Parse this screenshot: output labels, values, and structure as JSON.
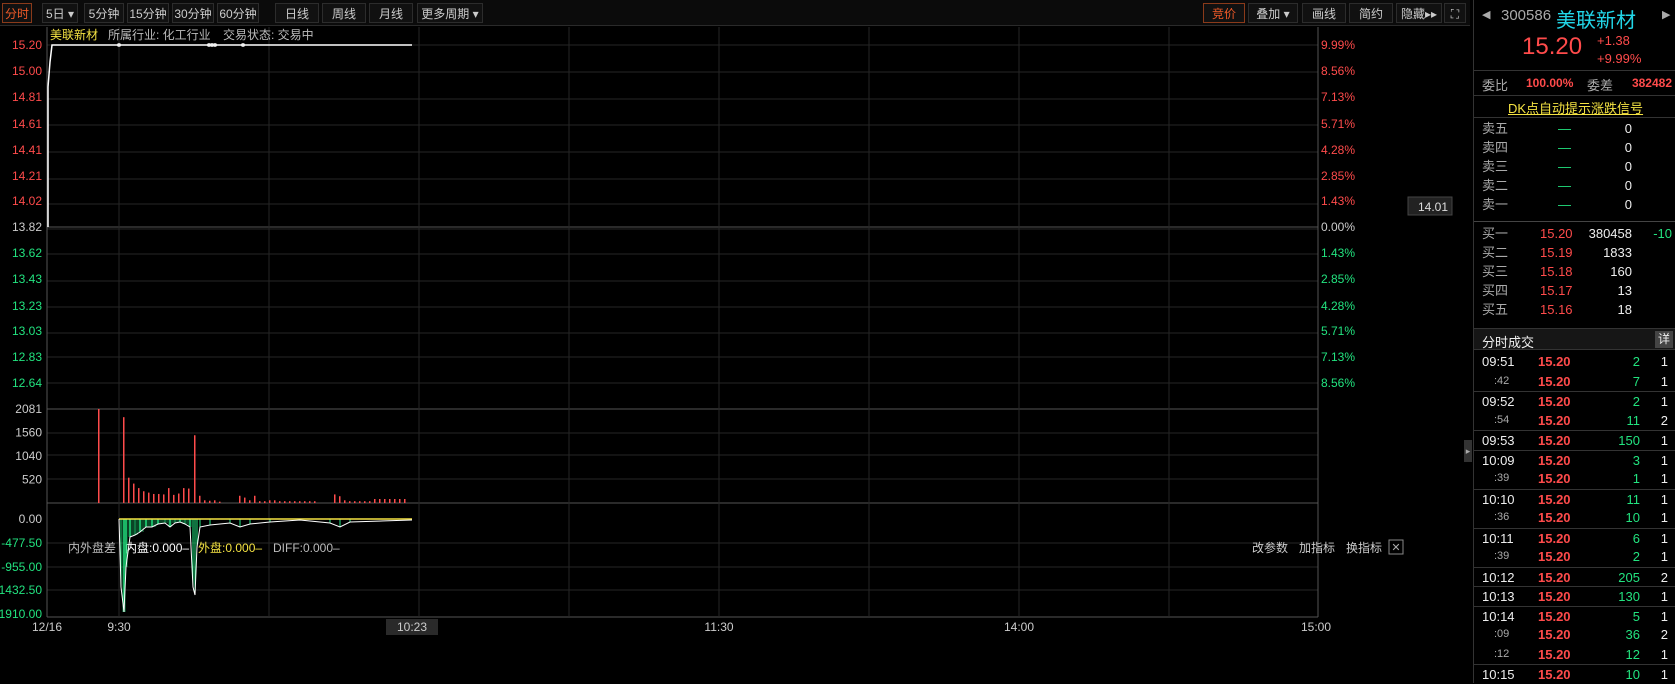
{
  "toolbar": {
    "left": [
      "分时",
      "5日",
      "5分钟",
      "15分钟",
      "30分钟",
      "60分钟",
      "日线",
      "周线",
      "月线",
      "更多周期"
    ],
    "right": [
      "竞价",
      "叠加",
      "画线",
      "简约",
      "隐藏"
    ]
  },
  "info": {
    "name": "美联新材",
    "industry": "所属行业: 化工行业",
    "status": "交易状态: 交易中"
  },
  "price_axis": {
    "left": [
      "15.20",
      "15.00",
      "14.81",
      "14.61",
      "14.41",
      "14.21",
      "14.02",
      "13.82",
      "13.62",
      "13.43",
      "13.23",
      "13.03",
      "12.83",
      "12.64"
    ],
    "right": [
      "9.99%",
      "8.56%",
      "7.13%",
      "5.71%",
      "4.28%",
      "2.85%",
      "1.43%",
      "0.00%",
      "1.43%",
      "2.85%",
      "4.28%",
      "5.71%",
      "7.13%",
      "8.56%"
    ],
    "cursor": "14.01"
  },
  "volume_axis": [
    "2081",
    "1560",
    "1040",
    "520"
  ],
  "indicator": {
    "name": "内外盘差",
    "inner": "内盘:0.000–",
    "outer": "外盘:0.000–",
    "diff": "DIFF:0.000–",
    "axis": [
      "0.00",
      "-477.50",
      "-955.00",
      "-1432.50",
      "-1910.00"
    ],
    "buttons": [
      "改参数",
      "加指标",
      "换指标"
    ]
  },
  "time_axis": {
    "date": "12/16",
    "labels": [
      "9:30",
      "10:23",
      "11:30",
      "14:00",
      "15:00"
    ]
  },
  "quote": {
    "code": "300586",
    "name": "美联新材",
    "price": "15.20",
    "change": "+1.38",
    "pct": "+9.99%",
    "ratio_label": "委比",
    "ratio": "100.00%",
    "diff_label": "委差",
    "diff": "382482",
    "link": "DK点自动提示涨跌信号"
  },
  "sells": [
    {
      "label": "卖五",
      "price": "—",
      "vol": "0"
    },
    {
      "label": "卖四",
      "price": "—",
      "vol": "0"
    },
    {
      "label": "卖三",
      "price": "—",
      "vol": "0"
    },
    {
      "label": "卖二",
      "price": "—",
      "vol": "0"
    },
    {
      "label": "卖一",
      "price": "—",
      "vol": "0"
    }
  ],
  "buys": [
    {
      "label": "买一",
      "price": "15.20",
      "vol": "380458",
      "chg": "-10"
    },
    {
      "label": "买二",
      "price": "15.19",
      "vol": "1833",
      "chg": ""
    },
    {
      "label": "买三",
      "price": "15.18",
      "vol": "160",
      "chg": ""
    },
    {
      "label": "买四",
      "price": "15.17",
      "vol": "13",
      "chg": ""
    },
    {
      "label": "买五",
      "price": "15.16",
      "vol": "18",
      "chg": ""
    }
  ],
  "ticks_title": "分时成交",
  "ticks_btn": "详",
  "ticks": [
    {
      "t": "09:51",
      "p": "15.20",
      "v": "2",
      "n": "1"
    },
    {
      "t": ":42",
      "p": "15.20",
      "v": "7",
      "n": "1"
    },
    {
      "t": "09:52",
      "p": "15.20",
      "v": "2",
      "n": "1"
    },
    {
      "t": ":54",
      "p": "15.20",
      "v": "11",
      "n": "2"
    },
    {
      "t": "09:53",
      "p": "15.20",
      "v": "150",
      "n": "1"
    },
    {
      "t": "10:09",
      "p": "15.20",
      "v": "3",
      "n": "1"
    },
    {
      "t": ":39",
      "p": "15.20",
      "v": "1",
      "n": "1"
    },
    {
      "t": "10:10",
      "p": "15.20",
      "v": "11",
      "n": "1"
    },
    {
      "t": ":36",
      "p": "15.20",
      "v": "10",
      "n": "1"
    },
    {
      "t": "10:11",
      "p": "15.20",
      "v": "6",
      "n": "1"
    },
    {
      "t": ":39",
      "p": "15.20",
      "v": "2",
      "n": "1"
    },
    {
      "t": "10:12",
      "p": "15.20",
      "v": "205",
      "n": "2"
    },
    {
      "t": "10:13",
      "p": "15.20",
      "v": "130",
      "n": "1"
    },
    {
      "t": "10:14",
      "p": "15.20",
      "v": "5",
      "n": "1"
    },
    {
      "t": ":09",
      "p": "15.20",
      "v": "36",
      "n": "2"
    },
    {
      "t": ":12",
      "p": "15.20",
      "v": "12",
      "n": "1"
    },
    {
      "t": "10:15",
      "p": "15.20",
      "v": "10",
      "n": "1"
    }
  ],
  "colors": {
    "up": "#ff4b4b",
    "down": "#22e37f",
    "accent": "#f05a28",
    "yellow": "#f5e342"
  }
}
